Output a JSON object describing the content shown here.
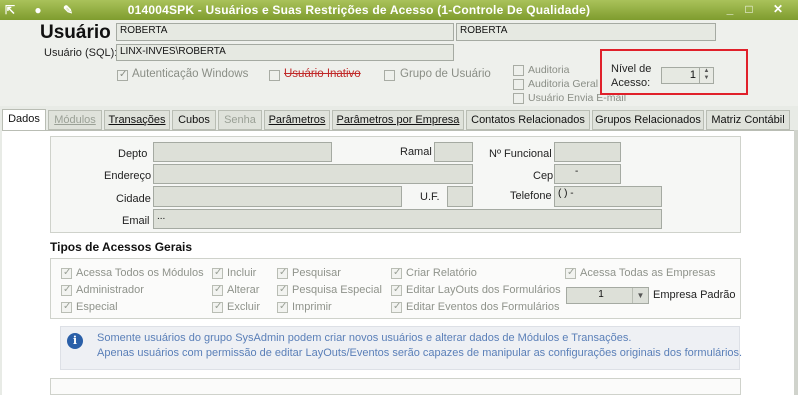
{
  "window": {
    "title": "014004SPK - Usuários e Suas Restrições de Acesso (1-Controle De Qualidade)",
    "controls": [
      "_",
      "□",
      "✕"
    ]
  },
  "header": {
    "usuario_label": "Usuário",
    "usuario_value": "ROBERTA",
    "usuario_name": "ROBERTA",
    "usuario_sql_label": "Usuário (SQL):",
    "usuario_sql_value": "LINX-INVES\\ROBERTA",
    "autenticacao_windows": "Autenticação Windows",
    "usuario_inativo": "Usuário Inativo",
    "grupo_usuario": "Grupo de Usuário",
    "auditoria": "Auditoria",
    "auditoria_geral": "Auditoria Geral",
    "usuario_envia_email": "Usuário Envia E-mail",
    "nivel_acesso_label_1": "Nível de",
    "nivel_acesso_label_2": "Acesso:",
    "nivel_acesso_value": "1"
  },
  "tabs": [
    "Dados",
    "Módulos",
    "Transações",
    "Cubos",
    "Senha",
    "Parâmetros",
    "Parâmetros por Empresa",
    "Contatos Relacionados",
    "Grupos Relacionados",
    "Matriz Contábil"
  ],
  "dados": {
    "depto_label": "Depto",
    "ramal_label": "Ramal",
    "n_funcional_label": "Nº Funcional",
    "endereco_label": "Endereço",
    "cep_label": "Cep",
    "cep_value": "-",
    "cidade_label": "Cidade",
    "uf_label": "U.F.",
    "telefone_label": "Telefone",
    "telefone_value": "(  )    -",
    "email_label": "Email",
    "email_value": "..."
  },
  "tipos": {
    "title": "Tipos de Acessos Gerais",
    "col1": [
      "Acessa Todos os Módulos",
      "Administrador",
      "Especial"
    ],
    "col2": [
      "Incluir",
      "Alterar",
      "Excluir"
    ],
    "col3": [
      "Pesquisar",
      "Pesquisa Especial",
      "Imprimir"
    ],
    "col4": [
      "Criar Relatório",
      "Editar LayOuts dos Formulários",
      "Editar Eventos dos Formulários"
    ],
    "acessa_todas_empresas": "Acessa Todas as Empresas",
    "empresa_padrao_value": "1",
    "empresa_padrao_label": "Empresa Padrão"
  },
  "info": {
    "line1": "Somente usuários do grupo SysAdmin podem criar novos usuários e alterar dados de Módulos e Transações.",
    "line2": "Apenas usuários com permissão de editar LayOuts/Eventos serão capazes de manipular as configurações originais dos formulários."
  }
}
